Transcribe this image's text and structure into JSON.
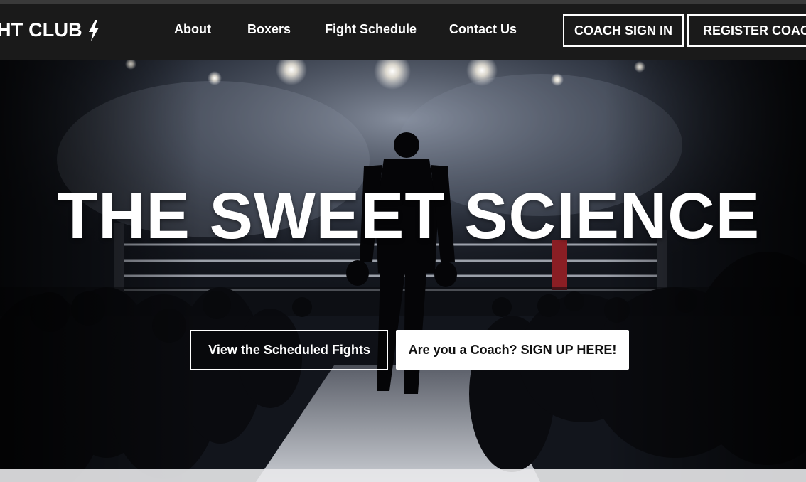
{
  "nav": {
    "brand": "HT CLUB",
    "brand_icon": "lightning-bolt-icon",
    "links": [
      "About",
      "Boxers",
      "Fight Schedule",
      "Contact Us"
    ],
    "coach_sign_in": "COACH SIGN IN",
    "register_coach": "REGISTER COACH"
  },
  "hero": {
    "headline": "THE SWEET SCIENCE",
    "primary_button": "View the Scheduled Fights",
    "secondary_button": "Are you a Coach? SIGN UP HERE!"
  },
  "colors": {
    "navbar_bg": "#1a1a1a",
    "text": "#ffffff",
    "secondary_button_bg": "#ffffff"
  }
}
